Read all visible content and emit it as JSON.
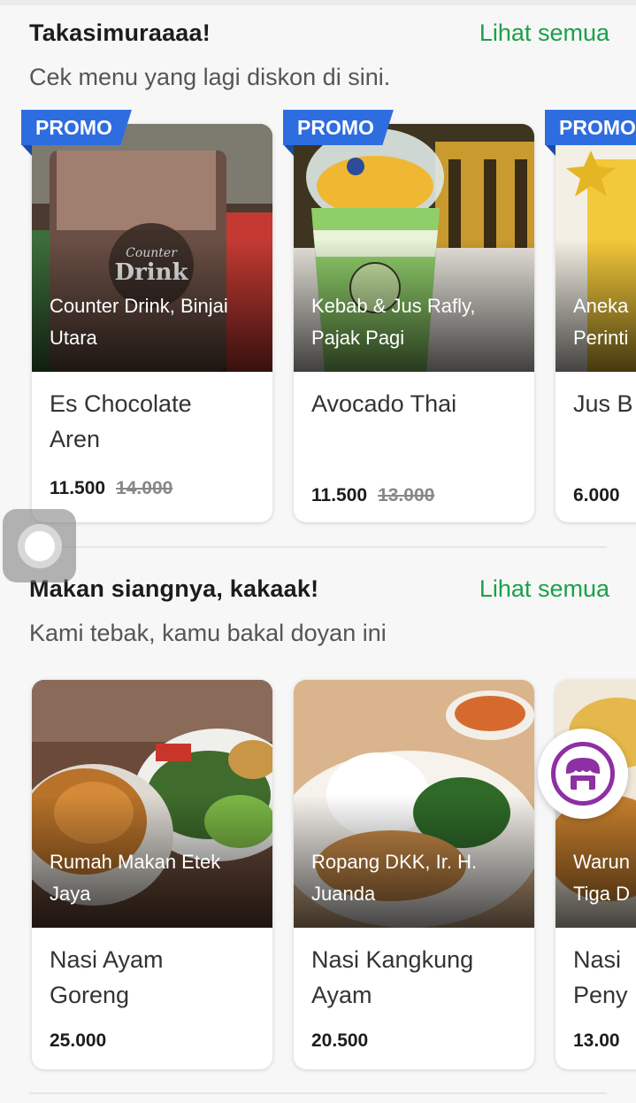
{
  "section1": {
    "title": "Takasimuraaaa!",
    "link": "Lihat semua",
    "subtitle": "Cek menu yang lagi diskon di sini.",
    "cards": [
      {
        "promo": "PROMO",
        "resto_line1": "Counter Drink, Binjai",
        "resto_line2": "Utara",
        "dish_line1": "Es Chocolate",
        "dish_line2": "Aren",
        "price": "11.500",
        "old_price": "14.000"
      },
      {
        "promo": "PROMO",
        "resto_line1": "Kebab & Jus Rafly,",
        "resto_line2": "Pajak Pagi",
        "dish_line1": "Avocado Thai",
        "dish_line2": "",
        "price": "11.500",
        "old_price": "13.000"
      },
      {
        "promo": "PROMO",
        "resto_line1": "Aneka",
        "resto_line2": "Perinti",
        "dish_line1": "Jus B",
        "dish_line2": "",
        "price": "6.000",
        "old_price": ""
      }
    ]
  },
  "section2": {
    "title": "Makan siangnya, kakaak!",
    "link": "Lihat semua",
    "subtitle": "Kami tebak, kamu bakal doyan ini",
    "cards": [
      {
        "resto_line1": "Rumah Makan Etek",
        "resto_line2": "Jaya",
        "dish_line1": "Nasi Ayam",
        "dish_line2": "Goreng",
        "price": "25.000"
      },
      {
        "resto_line1": "Ropang DKK, Ir. H.",
        "resto_line2": "Juanda",
        "dish_line1": "Nasi Kangkung",
        "dish_line2": "Ayam",
        "price": "20.500"
      },
      {
        "resto_line1": "Warun",
        "resto_line2": "Tiga D",
        "dish_line1": "Nasi",
        "dish_line2": "Peny",
        "price": "13.00"
      }
    ]
  },
  "colors": {
    "link_green": "#1aa04a",
    "promo_blue": "#2e6de0",
    "fab_purple": "#8e2fa3"
  },
  "icons": {
    "floating": "assistive-touch-icon",
    "fab": "merchant-icon"
  }
}
